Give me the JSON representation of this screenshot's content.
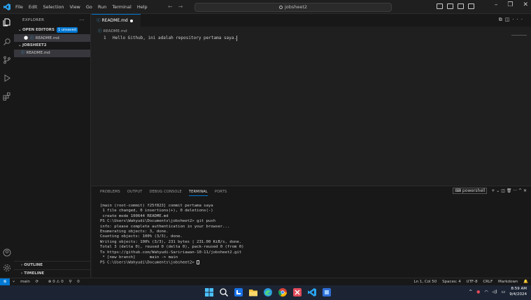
{
  "titlebar": {
    "menu": [
      "File",
      "Edit",
      "Selection",
      "View",
      "Go",
      "Run",
      "Terminal",
      "Help"
    ],
    "search_text": "jobsheet2",
    "window_controls": [
      "–",
      "❐",
      "✕"
    ]
  },
  "sidebar": {
    "header": "EXPLORER",
    "open_editors_label": "OPEN EDITORS",
    "open_editors_badge": "1 unsaved",
    "open_file": "README.md",
    "folder_label": "JOBSHEET2",
    "folder_file": "README.md",
    "outline_label": "OUTLINE",
    "timeline_label": "TIMELINE"
  },
  "editor": {
    "tab_label": "README.md",
    "breadcrumb": "README.md",
    "line_number": "1",
    "line_text": "Hello Github, ini adalah repository pertama saya."
  },
  "panel": {
    "tabs": [
      "PROBLEMS",
      "OUTPUT",
      "DEBUG CONSOLE",
      "TERMINAL",
      "PORTS"
    ],
    "shell_label": "powershell",
    "terminal_lines": [
      "[main (root-commit) f25f823] commit pertama saya",
      " 1 file changed, 0 insertions(+), 0 deletions(-)",
      " create mode 100644 README.md",
      "PS C:\\Users\\Wahyudi\\Documents\\jobsheet2> git push",
      "info: please complete authentication in your browser...",
      "Enumerating objects: 3, done.",
      "Counting objects: 100% (3/3), done.",
      "Writing objects: 100% (3/3), 231 bytes | 231.00 KiB/s, done.",
      "Total 3 (delta 0), reused 0 (delta 0), pack-reused 0 (from 0)",
      "To https://github.com/Wahyudi-Saririawan-10-11/jobsheet2.git",
      " * [new branch]      main -> main",
      "PS C:\\Users\\Wahyudi\\Documents\\jobsheet2> "
    ]
  },
  "statusbar": {
    "branch": "main",
    "problems": "⊗ 0 ⚠ 0",
    "ports": "0",
    "position": "Ln 1, Col 50",
    "spaces": "Spaces: 4",
    "encoding": "UTF-8",
    "eol": "CRLF",
    "language": "Markdown"
  },
  "taskbar": {
    "time": "8:59 AM",
    "date": "9/4/2024"
  },
  "colors": {
    "accent": "#0078d4",
    "background": "#1f1f1f"
  }
}
